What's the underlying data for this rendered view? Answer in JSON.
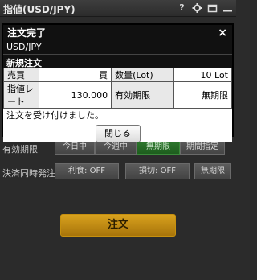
{
  "window": {
    "title": "指値(USD/JPY)"
  },
  "form": {
    "validity_label": "有効期限",
    "validity_options": [
      "今日中",
      "今週中",
      "無期限",
      "期間指定"
    ],
    "validity_selected": "無期限",
    "settlement_label": "決済同時発注",
    "take_profit": "利食: OFF",
    "stop_loss": "損切: OFF",
    "settlement_validity": "無期限",
    "order_button": "注文"
  },
  "modal": {
    "title": "注文完了",
    "close_glyph": "×",
    "pair": "USD/JPY",
    "order_type": "新規注文",
    "rows": [
      {
        "label1": "売買",
        "value1": "買",
        "label2": "数量(Lot)",
        "value2": "10 Lot"
      },
      {
        "label1": "指値レート",
        "value1": "130.000",
        "label2": "有効期限",
        "value2": "無期限"
      }
    ],
    "message": "注文を受け付けました。",
    "close_button": "閉じる"
  },
  "colors": {
    "buy": "#d00000",
    "order_button": "#c6900f",
    "active_segment": "#2f7a2f"
  }
}
